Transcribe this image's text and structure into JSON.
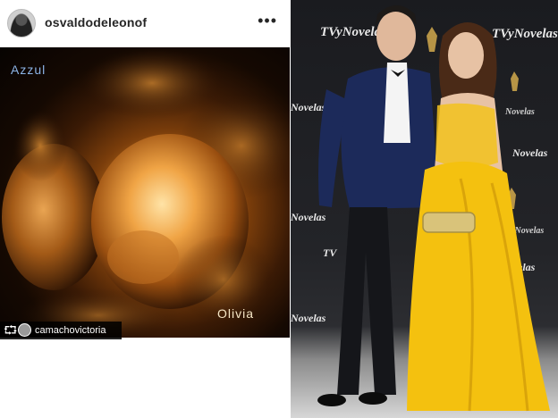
{
  "post": {
    "username": "osvaldodeleonof",
    "more_icon": "more-horizontal-icon",
    "more_glyph": "•••",
    "image_labels": {
      "left": "Azzul",
      "right": "Olivia"
    },
    "repost": {
      "icon": "repost-icon",
      "glyph": "⮔",
      "user": "camachovictoria"
    }
  },
  "event": {
    "backdrop_brand": "TVyNovelas",
    "backdrop_brand_short": "Novelas",
    "backdrop_brand_prefix": "TV"
  }
}
